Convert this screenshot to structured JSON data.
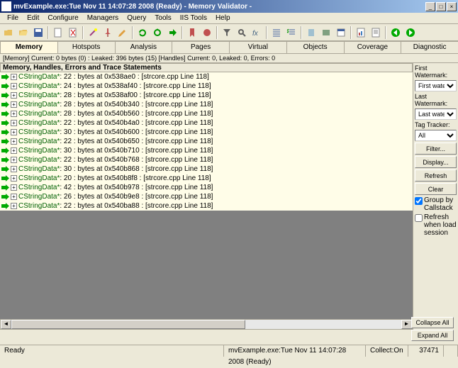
{
  "window": {
    "title": "mvExample.exe:Tue Nov 11 14:07:28 2008 (Ready) - Memory Validator -"
  },
  "menu": [
    "File",
    "Edit",
    "Configure",
    "Managers",
    "Query",
    "Tools",
    "IIS Tools",
    "Help"
  ],
  "tabs": [
    "Memory",
    "Hotspots",
    "Analysis",
    "Pages",
    "Virtual",
    "Objects",
    "Coverage",
    "Diagnostic"
  ],
  "active_tab": 0,
  "status_line": "[Memory] Current: 0 bytes (0) : Leaked: 396 bytes (15) [Handles] Current: 0, Leaked: 0, Errors: 0",
  "panel_header": "Memory, Handles, Errors and Trace Statements",
  "tree_rows": [
    {
      "cls": "CStringData*",
      "size": 22,
      "addr": "0x538ae0",
      "src": "[strcore.cpp Line 118]"
    },
    {
      "cls": "CStringData*",
      "size": 24,
      "addr": "0x538af40",
      "src": "[strcore.cpp Line 118]"
    },
    {
      "cls": "CStringData*",
      "size": 28,
      "addr": "0x538af00",
      "src": "[strcore.cpp Line 118]"
    },
    {
      "cls": "CStringData*",
      "size": 28,
      "addr": "0x540b340",
      "src": "[strcore.cpp Line 118]"
    },
    {
      "cls": "CStringData*",
      "size": 28,
      "addr": "0x540b560",
      "src": "[strcore.cpp Line 118]"
    },
    {
      "cls": "CStringData*",
      "size": 22,
      "addr": "0x540b4a0",
      "src": "[strcore.cpp Line 118]"
    },
    {
      "cls": "CStringData*",
      "size": 30,
      "addr": "0x540b600",
      "src": "[strcore.cpp Line 118]"
    },
    {
      "cls": "CStringData*",
      "size": 22,
      "addr": "0x540b650",
      "src": "[strcore.cpp Line 118]"
    },
    {
      "cls": "CStringData*",
      "size": 30,
      "addr": "0x540b710",
      "src": "[strcore.cpp Line 118]"
    },
    {
      "cls": "CStringData*",
      "size": 22,
      "addr": "0x540b768",
      "src": "[strcore.cpp Line 118]"
    },
    {
      "cls": "CStringData*",
      "size": 30,
      "addr": "0x540b868",
      "src": "[strcore.cpp Line 118]"
    },
    {
      "cls": "CStringData*",
      "size": 20,
      "addr": "0x540b8f8",
      "src": "[strcore.cpp Line 118]"
    },
    {
      "cls": "CStringData*",
      "size": 42,
      "addr": "0x540b978",
      "src": "[strcore.cpp Line 118]"
    },
    {
      "cls": "CStringData*",
      "size": 26,
      "addr": "0x540b9e8",
      "src": "[strcore.cpp Line 118]"
    },
    {
      "cls": "CStringData*",
      "size": 22,
      "addr": "0x540ba88",
      "src": "[strcore.cpp Line 118]"
    }
  ],
  "sidebar": {
    "first_wm_label": "First Watermark:",
    "first_wm_value": "First watermark",
    "last_wm_label": "Last Watermark:",
    "last_wm_value": "Last watermark",
    "tag_tracker_label": "Tag Tracker:",
    "tag_tracker_value": "All",
    "filter_btn": "Filter...",
    "display_btn": "Display...",
    "refresh_btn": "Refresh",
    "clear_btn": "Clear",
    "group_chk": "Group by Callstack",
    "refresh_chk": "Refresh when load session"
  },
  "bottom": {
    "collapse": "Collapse All",
    "expand": "Expand All"
  },
  "statusbar": {
    "ready": "Ready",
    "exe": "mvExample.exe:Tue Nov 11 14:07:28 2008 (Ready)",
    "collect_label": "Collect:On",
    "num": "37471"
  }
}
